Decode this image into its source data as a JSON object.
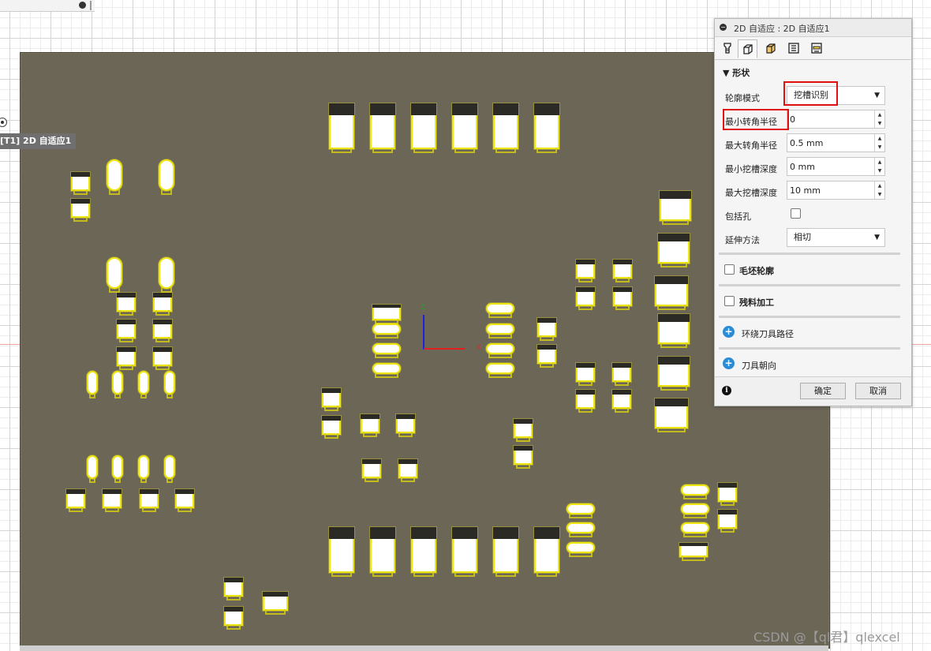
{
  "canvas": {
    "operation_label": "[T1] 2D 自适应1",
    "watermark": "CSDN @【ql君】qlexcel",
    "axis_labels": {
      "z": "Z",
      "x": "X"
    }
  },
  "panel": {
    "title": "2D 自适应 : 2D 自适应1",
    "tabs": [
      {
        "icon": "tool-icon",
        "active": false
      },
      {
        "icon": "geometry-icon",
        "active": true
      },
      {
        "icon": "heights-icon",
        "active": false
      },
      {
        "icon": "passes-icon",
        "active": false
      },
      {
        "icon": "linking-icon",
        "active": false
      }
    ],
    "section_title": "形状",
    "contour_mode": {
      "label": "轮廓模式",
      "value": "挖槽识别"
    },
    "min_corner_radius": {
      "label": "最小转角半径",
      "value": "0"
    },
    "max_corner_radius": {
      "label": "最大转角半径",
      "value": "0.5 mm"
    },
    "min_pocket_depth": {
      "label": "最小挖槽深度",
      "value": "0 mm"
    },
    "max_pocket_depth": {
      "label": "最大挖槽深度",
      "value": "10 mm"
    },
    "include_holes": {
      "label": "包括孔",
      "checked": false
    },
    "extend_method": {
      "label": "延伸方法",
      "value": "相切"
    },
    "stock_contour": {
      "label": "毛坯轮廓",
      "checked": false
    },
    "rest_machining": {
      "label": "残料加工",
      "checked": false
    },
    "tool_around_path": {
      "label": "环绕刀具路径"
    },
    "tool_orientation": {
      "label": "刀具朝向"
    },
    "ok_label": "确定",
    "cancel_label": "取消",
    "highlight_color": "#e01010"
  },
  "colors": {
    "board": "#6c6657",
    "pad_outline": "#efe60f",
    "accent_blue": "#2a8bd6"
  }
}
